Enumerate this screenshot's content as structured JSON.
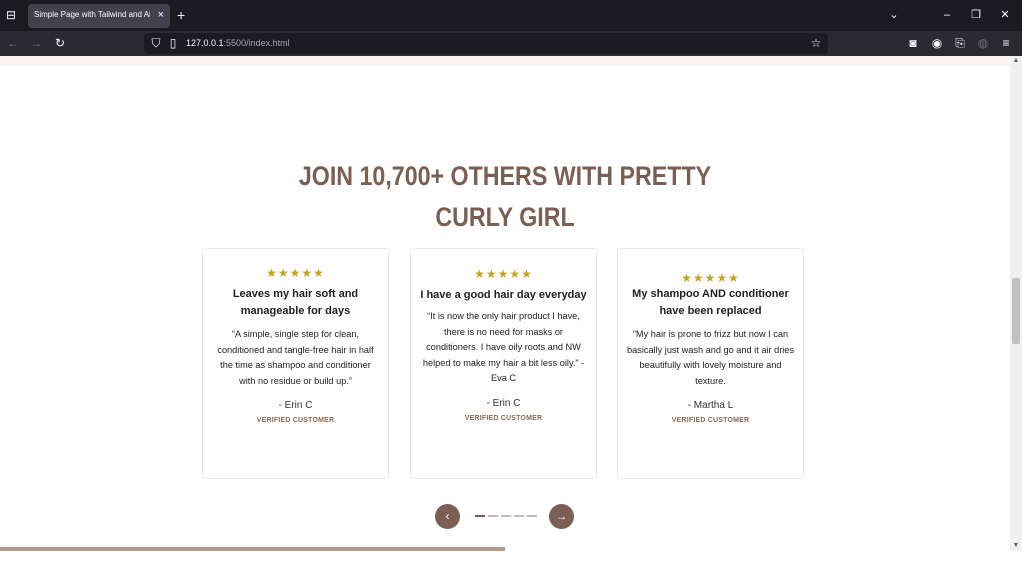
{
  "browser": {
    "tab_title": "Simple Page with Tailwind and Alpine",
    "tab_close": "×",
    "new_tab": "+",
    "url_host": "127.0.0.1",
    "url_path": ":5500/index.html",
    "icons": {
      "tab_list": "tab-list-icon",
      "back": "back-arrow-icon",
      "forward": "forward-arrow-icon",
      "reload": "reload-icon",
      "shield": "shield-icon",
      "page": "page-icon",
      "bookmark": "star-icon",
      "pocket": "pocket-icon",
      "account": "account-icon",
      "extensions": "extensions-icon",
      "profile": "profile-icon",
      "menu": "hamburger-menu-icon"
    }
  },
  "section": {
    "headline_line1": "JOIN 10,700+ OTHERS WITH PRETTY",
    "headline_line2": "CURLY GIRL"
  },
  "testimonials": [
    {
      "stars": "★★★★★",
      "title": "Leaves my hair soft and manageable for days",
      "quote": "“A simple, single step for clean, conditioned and tangle-free hair in half the time as shampoo and conditioner with no residue or build up.”",
      "author": "- Erin C",
      "verified": "VERIFIED CUSTOMER"
    },
    {
      "stars": "★★★★★",
      "title": "I have a good hair day everyday",
      "quote": "“It is now the only hair product I have, there is no need for masks or conditioners. I have oily roots and NW helped to make my hair a bit less oily.” - Eva C",
      "author": "- Erin C",
      "verified": "VERIFIED CUSTOMER"
    },
    {
      "stars": "★★★★★",
      "title": "My shampoo AND conditioner have been replaced",
      "quote": "“My hair is prone to frizz but now I can basically just wash and go and it air dries beautifully with lovely moisture and texture.",
      "author": "- Martha L",
      "verified": "VERIFIED CUSTOMER"
    }
  ],
  "carousel": {
    "prev_icon": "chevron-left-icon",
    "next_icon": "arrow-right-icon",
    "dot_count": 5,
    "active_dot": 1,
    "progress": 0.5
  },
  "colors": {
    "accent": "#7a5f52",
    "stars": "#c3a41f",
    "progress": "#b49a8e"
  }
}
